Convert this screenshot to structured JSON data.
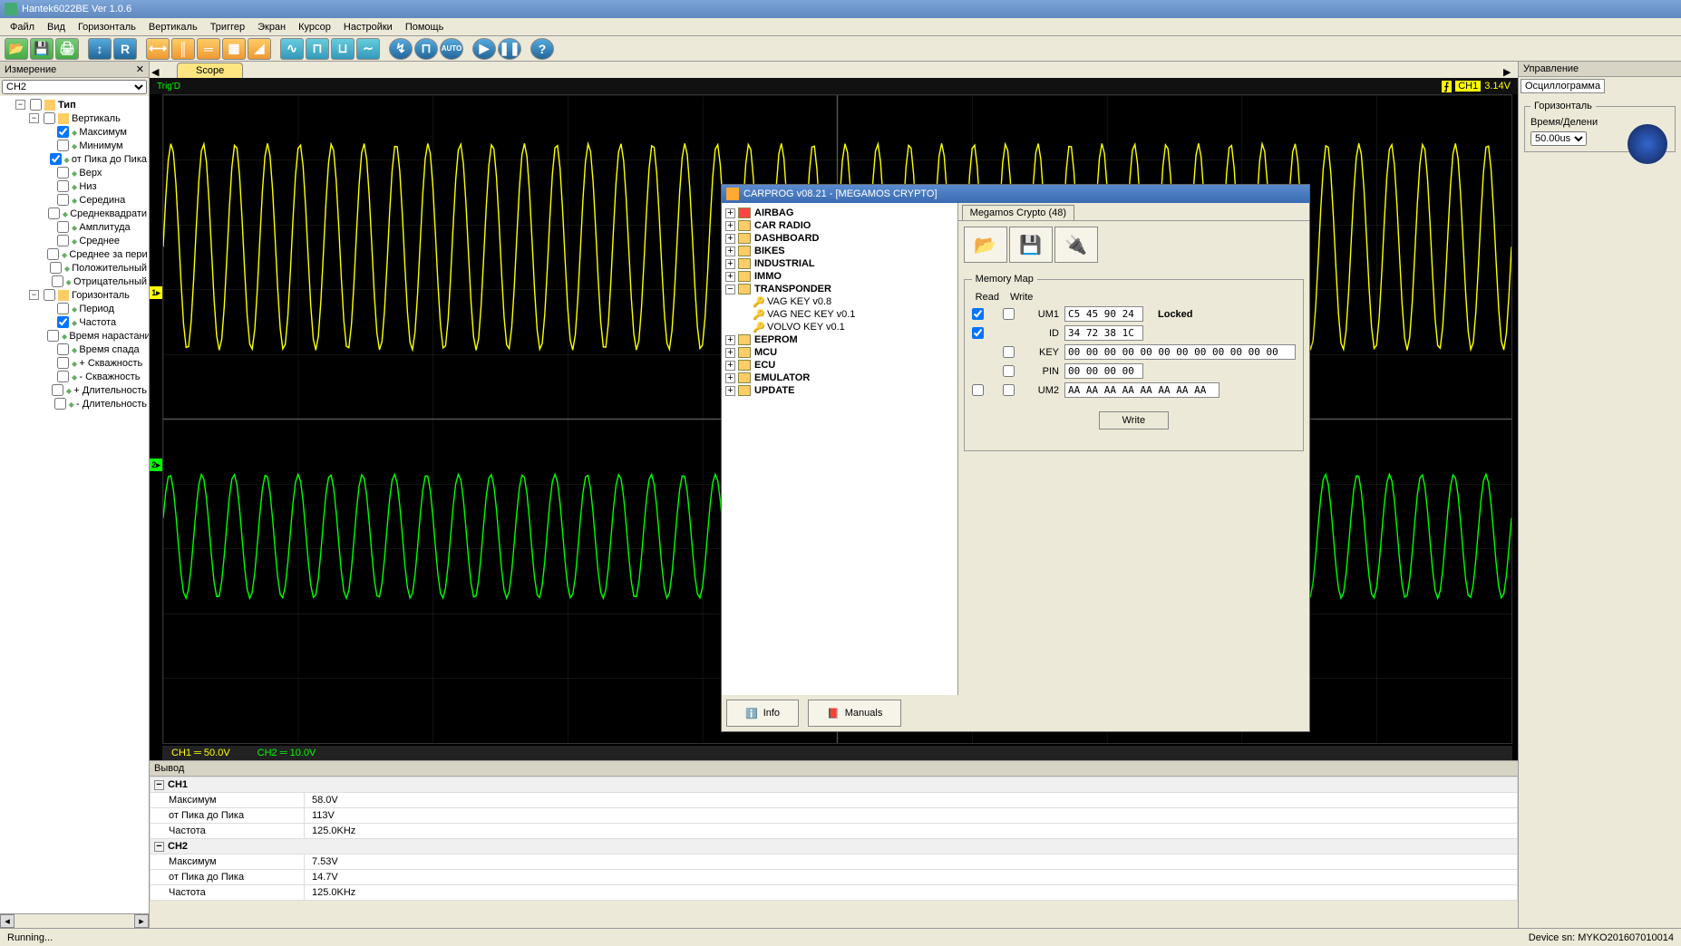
{
  "window": {
    "title": "Hantek6022BE Ver 1.0.6"
  },
  "menu": [
    "Файл",
    "Вид",
    "Горизонталь",
    "Вертикаль",
    "Триггер",
    "Экран",
    "Курсор",
    "Настройки",
    "Помощь"
  ],
  "tab": "Scope",
  "leftpanel": {
    "title": "Измерение",
    "channel": "CH2",
    "tree": {
      "root": "Тип",
      "vertical": {
        "label": "Вертикаль",
        "items": [
          {
            "label": "Максимум",
            "checked": true
          },
          {
            "label": "Минимум",
            "checked": false
          },
          {
            "label": "от Пика до Пика",
            "checked": true
          },
          {
            "label": "Верх",
            "checked": false
          },
          {
            "label": "Низ",
            "checked": false
          },
          {
            "label": "Середина",
            "checked": false
          },
          {
            "label": "Среднеквадрати",
            "checked": false
          },
          {
            "label": "Амплитуда",
            "checked": false
          },
          {
            "label": "Среднее",
            "checked": false
          },
          {
            "label": "Среднее за пери",
            "checked": false
          },
          {
            "label": "Положительный",
            "checked": false
          },
          {
            "label": "Отрицательный",
            "checked": false
          }
        ]
      },
      "horizontal": {
        "label": "Горизонталь",
        "items": [
          {
            "label": "Период",
            "checked": false
          },
          {
            "label": "Частота",
            "checked": true
          },
          {
            "label": "Время нарастани",
            "checked": false
          },
          {
            "label": "Время спада",
            "checked": false
          },
          {
            "label": "+ Скважность",
            "checked": false
          },
          {
            "label": "- Скважность",
            "checked": false
          },
          {
            "label": "+ Длительность",
            "checked": false
          },
          {
            "label": "- Длительность",
            "checked": false
          }
        ]
      }
    }
  },
  "scope": {
    "trigd": "Trig'D",
    "trig_ch": "CH1",
    "trig_v": "3.14V",
    "ch1_scale": "CH1 ═ 50.0V",
    "ch2_scale": "CH2 ═ 10.0V"
  },
  "output": {
    "title": "Вывод",
    "ch1": {
      "name": "CH1",
      "rows": [
        {
          "k": "Максимум",
          "v": "58.0V"
        },
        {
          "k": "от Пика до Пика",
          "v": "113V"
        },
        {
          "k": "Частота",
          "v": "125.0KHz"
        }
      ]
    },
    "ch2": {
      "name": "CH2",
      "rows": [
        {
          "k": "Максимум",
          "v": "7.53V"
        },
        {
          "k": "от Пика до Пика",
          "v": "14.7V"
        },
        {
          "k": "Частота",
          "v": "125.0KHz"
        }
      ]
    }
  },
  "rightpanel": {
    "title": "Управление",
    "tab": "Осциллограмма",
    "horiz_legend": "Горизонталь",
    "timediv_label": "Время/Делени",
    "timediv": "50.00us"
  },
  "carprog": {
    "title": "CARPROG  v08.21 - [MEGAMOS CRYPTO]",
    "tree": [
      {
        "label": "AIRBAG",
        "cls": "airbag"
      },
      {
        "label": "CAR RADIO"
      },
      {
        "label": "DASHBOARD"
      },
      {
        "label": "BIKES"
      },
      {
        "label": "INDUSTRIAL"
      },
      {
        "label": "IMMO"
      },
      {
        "label": "TRANSPONDER",
        "expanded": true,
        "children": [
          "VAG KEY v0.8",
          "VAG NEC KEY v0.1",
          "VOLVO KEY v0.1"
        ]
      },
      {
        "label": "EEPROM"
      },
      {
        "label": "MCU"
      },
      {
        "label": "ECU"
      },
      {
        "label": "EMULATOR"
      },
      {
        "label": "UPDATE"
      }
    ],
    "tab": "Megamos Crypto (48)",
    "memmap": {
      "legend": "Memory Map",
      "read": "Read",
      "write": "Write",
      "rows": [
        {
          "lbl": "UM1",
          "val": "C5 45 90 24",
          "extra": "Locked",
          "r": true,
          "w": false
        },
        {
          "lbl": "ID",
          "val": "34 72 38 1C",
          "r": true,
          "w": null
        },
        {
          "lbl": "KEY",
          "val": "00 00 00 00 00 00 00 00 00 00 00 00",
          "r": null,
          "w": false
        },
        {
          "lbl": "PIN",
          "val": "00 00 00 00",
          "r": null,
          "w": false
        },
        {
          "lbl": "UM2",
          "val": "AA AA AA AA AA AA AA AA",
          "r": false,
          "w": false
        }
      ],
      "writebtn": "Write"
    },
    "info": "Info",
    "manuals": "Manuals"
  },
  "status": {
    "running": "Running...",
    "device": "Device sn: MYKO201607010014"
  }
}
